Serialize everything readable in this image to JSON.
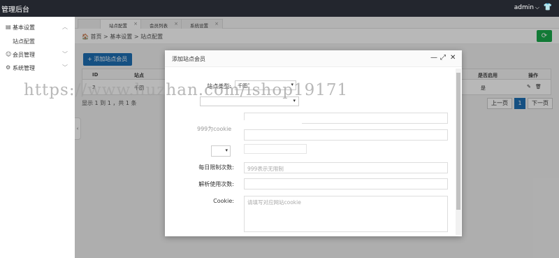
{
  "app": {
    "title": "管理后台",
    "user": "admin",
    "user_caret": "⌵",
    "shirt_icon": "👕"
  },
  "sidebar": {
    "items": [
      {
        "icon": "▤",
        "label": "基本设置",
        "chevron": "︿"
      },
      {
        "icon": "☺",
        "label": "会员管理",
        "chevron": "﹀"
      },
      {
        "icon": "⚙",
        "label": "系统管理",
        "chevron": "﹀"
      }
    ],
    "sub_items": [
      "站点配置"
    ]
  },
  "tabs": [
    {
      "label": "",
      "close": ""
    },
    {
      "label": "站点配置",
      "close": "×"
    },
    {
      "label": "会员列表",
      "close": "×"
    },
    {
      "label": "系统设置",
      "close": "×"
    }
  ],
  "breadcrumb": "🏠 首页  >  基本设置  >  站点配置",
  "refresh_icon": "⟳",
  "add_button": "+ 添加站点会员",
  "table": {
    "headers": [
      "ID",
      "站点",
      "是否启用",
      "操作"
    ],
    "row": {
      "id": "3",
      "site": "千图",
      "enabled": "是",
      "edit_icon": "✎",
      "delete_icon": "🗑"
    }
  },
  "pager": {
    "info": "显示 1 到 1 ，共 1 条",
    "prev": "上一页",
    "current": "1",
    "next": "下一页"
  },
  "collapse_icon": "‹",
  "modal": {
    "title": "添加站点会员",
    "min_icon": "—",
    "max_icon": "⤢",
    "close_icon": "✕",
    "site_label": "站点类型:",
    "site_value": "千图",
    "site_caret": "▾",
    "cookie_placeholder_1": "999为cookie",
    "small_caret": "▾",
    "daily_label": "每日限制次数:",
    "daily_placeholder": "999表示无限制",
    "parse_label": "解析使用次数:",
    "parse_placeholder": "",
    "cookie_label": "Cookie:",
    "cookie_placeholder": "请填写对应网站cookie"
  },
  "watermark": "https://www.huzhan.com/ishop19171"
}
